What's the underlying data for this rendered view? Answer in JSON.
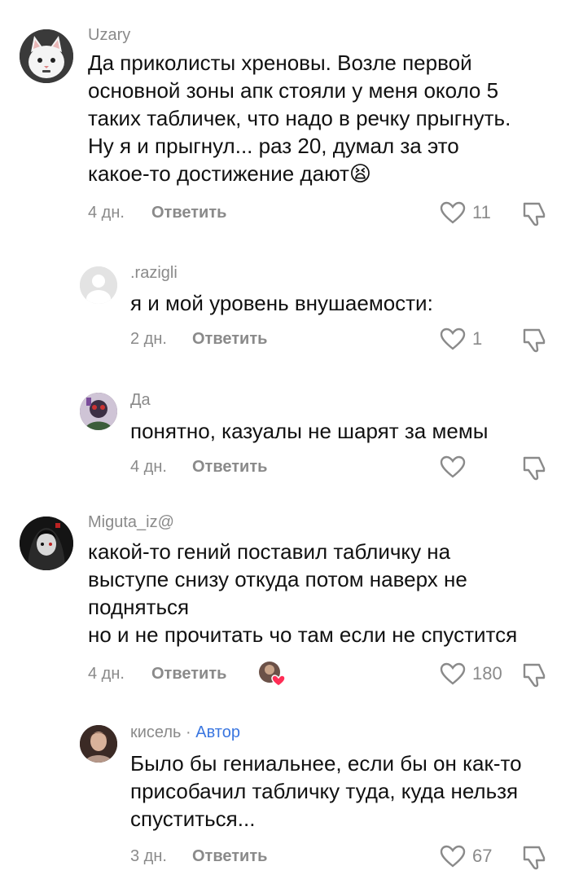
{
  "comments": [
    {
      "username": "Uzary",
      "text": "Да приколисты хреновы. Возле первой\nосновной зоны апк стояли у меня около 5\nтаких табличек, что надо в речку прыгнуть.\nНу я и прыгнул... раз 20, думал за это\nкакое-то достижение дают😫",
      "age": "4 дн.",
      "reply_label": "Ответить",
      "likes": "11"
    },
    {
      "username": ".razigli",
      "text": "я и мой уровень внушаемости:",
      "age": "2 дн.",
      "reply_label": "Ответить",
      "likes": "1"
    },
    {
      "username": "Да",
      "text": "понятно, казуалы не шарят за мемы",
      "age": "4 дн.",
      "reply_label": "Ответить",
      "likes": ""
    },
    {
      "username": "Miguta_iz@",
      "text": "какой-то гений поставил табличку на\nвыступе снизу откуда потом наверх не\nподняться\nно и не прочитать чо там если не спустится",
      "age": "4 дн.",
      "reply_label": "Ответить",
      "likes": "180"
    },
    {
      "username": "кисель",
      "author_badge": "Автор",
      "text": "Было бы гениальнее, если бы он как-то\nприсобачил табличку туда, куда нельзя\nспуститься...",
      "age": "3 дн.",
      "reply_label": "Ответить",
      "likes": "67"
    }
  ],
  "colors": {
    "meta": "#8a8a8a",
    "author_badge": "#3a76e0",
    "heart_badge": "#ff2d55"
  }
}
